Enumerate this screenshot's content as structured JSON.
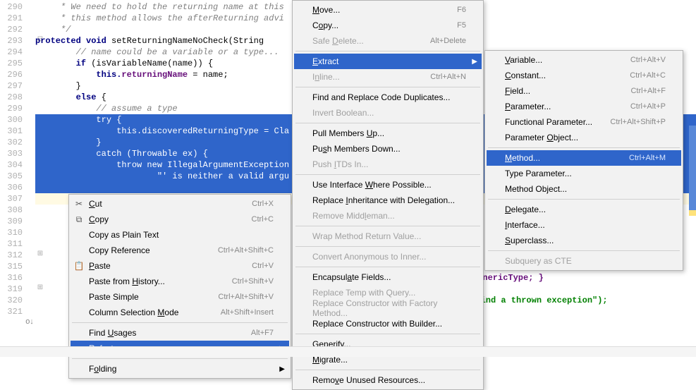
{
  "gutter": {
    "lines": [
      "290",
      "291",
      "292",
      "293",
      "294",
      "295",
      "296",
      "297",
      "298",
      "299",
      "300",
      "301",
      "302",
      "303",
      "304",
      "305",
      "306",
      "307",
      "308",
      "309",
      "310",
      "311",
      "312",
      "315",
      "316",
      "319",
      "320",
      "321"
    ]
  },
  "code": {
    "l290": "     * We need to hold the returning name at this ",
    "l291": "     * this method allows the afterReturning advi",
    "l292": "     */",
    "l293a": "protected void ",
    "l293b": "setReturningNameNoCheck",
    "l293c": "(String",
    "l294": "        // name could be a variable or a type...",
    "l295a": "        if ",
    "l295b": "(isVariableName(name)) {",
    "l296a": "            this.",
    "l296b": "returningName",
    "l296c": " = name;",
    "l297": "        }",
    "l298a": "        else ",
    "l298b": "{",
    "l299": "            // assume a type",
    "l300": "            try {",
    "l301a": "                this.",
    "l301b": "discoveredReturningType",
    "l301c": " = Cla",
    "l302": "            }",
    "l303": "            catch (Throwable ex) {",
    "l304a": "                throw new ",
    "l304b": "IllegalArgumentException",
    "l305": "                        \"' is neither a valid argu",
    "l311_tail": "; }",
    "l316_tail": "GenericType; }",
    "l320_tail": "o bind a thrown exception\");"
  },
  "menu1": {
    "cut": "Cut",
    "cut_sc": "Ctrl+X",
    "copy": "Copy",
    "copy_sc": "Ctrl+C",
    "copyplain": "Copy as Plain Text",
    "copyref": "Copy Reference",
    "copyref_sc": "Ctrl+Alt+Shift+C",
    "paste": "Paste",
    "paste_sc": "Ctrl+V",
    "pastehist": "Paste from History...",
    "pastehist_sc": "Ctrl+Shift+V",
    "pastesimple": "Paste Simple",
    "pastesimple_sc": "Ctrl+Alt+Shift+V",
    "colsel": "Column Selection Mode",
    "colsel_sc": "Alt+Shift+Insert",
    "findusages": "Find Usages",
    "findusages_sc": "Alt+F7",
    "refactor": "Refactor",
    "folding": "Folding"
  },
  "menu2": {
    "move": "Move...",
    "move_sc": "F6",
    "copy": "Copy...",
    "copy_sc": "F5",
    "safedelete": "Safe Delete...",
    "safedelete_sc": "Alt+Delete",
    "extract": "Extract",
    "inline": "Inline...",
    "inline_sc": "Ctrl+Alt+N",
    "findrepl": "Find and Replace Code Duplicates...",
    "invert": "Invert Boolean...",
    "pullup": "Pull Members Up...",
    "pushdown": "Push Members Down...",
    "pushitds": "Push ITDs In...",
    "useiface": "Use Interface Where Possible...",
    "replinh": "Replace Inheritance with Delegation...",
    "remmid": "Remove Middleman...",
    "wrapret": "Wrap Method Return Value...",
    "convanon": "Convert Anonymous to Inner...",
    "encap": "Encapsulate Fields...",
    "repltemp": "Replace Temp with Query...",
    "replcfact": "Replace Constructor with Factory Method...",
    "replcbuild": "Replace Constructor with Builder...",
    "generify": "Generify...",
    "migrate": "Migrate...",
    "remunused": "Remove Unused Resources..."
  },
  "menu3": {
    "variable": "Variable...",
    "variable_sc": "Ctrl+Alt+V",
    "constant": "Constant...",
    "constant_sc": "Ctrl+Alt+C",
    "field": "Field...",
    "field_sc": "Ctrl+Alt+F",
    "parameter": "Parameter...",
    "parameter_sc": "Ctrl+Alt+P",
    "funcparam": "Functional Parameter...",
    "funcparam_sc": "Ctrl+Alt+Shift+P",
    "paramobj": "Parameter Object...",
    "method": "Method...",
    "method_sc": "Ctrl+Alt+M",
    "typeparam": "Type Parameter...",
    "methodobj": "Method Object...",
    "delegate": "Delegate...",
    "interface": "Interface...",
    "superclass": "Superclass...",
    "subquery": "Subquery as CTE"
  }
}
